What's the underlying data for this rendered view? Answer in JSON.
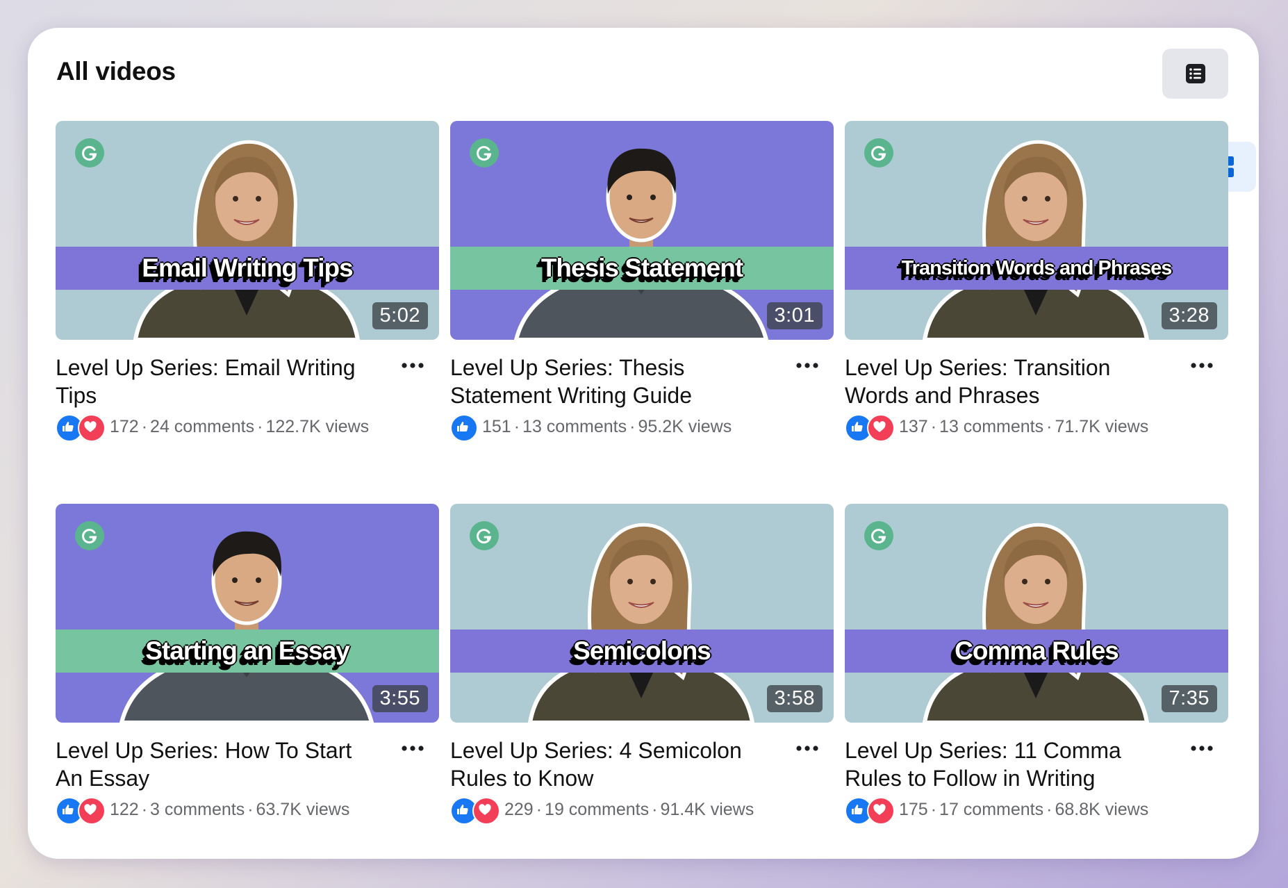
{
  "page": {
    "title": "All videos"
  },
  "view_toggle": {
    "list_icon": "list-icon",
    "grid_icon": "grid-icon",
    "active": "grid"
  },
  "colors": {
    "teal_bg": "#aecbd3",
    "purple_bg": "#7b78d9",
    "purple_band": "#7f74d8",
    "green_band": "#76c4a0",
    "like": "#1877f2",
    "love": "#f33e58"
  },
  "videos": [
    {
      "caption": "Email Writing Tips",
      "duration": "5:02",
      "title": "Level Up Series: Email Writing Tips",
      "reactions_count": "172",
      "comments": "24 comments",
      "views": "122.7K views",
      "reactions": [
        "like",
        "love"
      ],
      "theme": "teal-purple",
      "host": "woman"
    },
    {
      "caption": "Thesis Statement",
      "duration": "3:01",
      "title": "Level Up Series: Thesis Statement Writing Guide",
      "reactions_count": "151",
      "comments": "13 comments",
      "views": "95.2K views",
      "reactions": [
        "like"
      ],
      "theme": "purple-green",
      "host": "man"
    },
    {
      "caption": "Transition Words and Phrases",
      "duration": "3:28",
      "title": "Level Up Series: Transition Words and Phrases",
      "reactions_count": "137",
      "comments": "13 comments",
      "views": "71.7K views",
      "reactions": [
        "like",
        "love"
      ],
      "theme": "teal-purple",
      "host": "woman"
    },
    {
      "caption": "Starting an Essay",
      "duration": "3:55",
      "title": "Level Up Series: How To Start An Essay",
      "reactions_count": "122",
      "comments": "3 comments",
      "views": "63.7K views",
      "reactions": [
        "like",
        "love"
      ],
      "theme": "purple-green",
      "host": "man"
    },
    {
      "caption": "Semicolons",
      "duration": "3:58",
      "title": "Level Up Series: 4 Semicolon Rules to Know",
      "reactions_count": "229",
      "comments": "19 comments",
      "views": "91.4K views",
      "reactions": [
        "like",
        "love"
      ],
      "theme": "teal-purple",
      "host": "woman"
    },
    {
      "caption": "Comma Rules",
      "duration": "7:35",
      "title": "Level Up Series: 11 Comma Rules to Follow in Writing",
      "reactions_count": "175",
      "comments": "17 comments",
      "views": "68.8K views",
      "reactions": [
        "like",
        "love"
      ],
      "theme": "teal-purple",
      "host": "woman"
    }
  ]
}
